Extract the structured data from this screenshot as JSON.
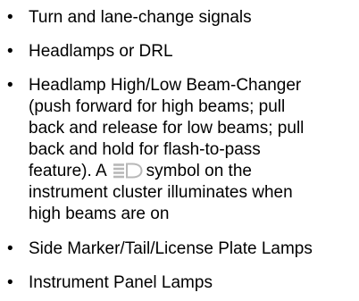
{
  "list": {
    "bullet": "•",
    "items": [
      {
        "lines": [
          "Turn and lane-change signals"
        ]
      },
      {
        "lines": [
          "Headlamps or DRL"
        ]
      },
      {
        "lines": [
          "Headlamp High/Low Beam-Changer",
          "(push forward for high beams; pull",
          "back and release for low beams; pull",
          "back and hold for flash-to-pass"
        ],
        "line5_pre": "feature).  A",
        "line5_post": "symbol on the",
        "line6": "instrument cluster illuminates when",
        "line7": "high beams are on",
        "icon": "high-beam-indicator-icon"
      },
      {
        "lines": [
          "Side Marker/Tail/License Plate Lamps"
        ]
      },
      {
        "lines": [
          "Instrument Panel Lamps"
        ]
      }
    ]
  },
  "colors": {
    "text": "#000000",
    "background": "#ffffff",
    "icon": "#b8b8b8"
  }
}
